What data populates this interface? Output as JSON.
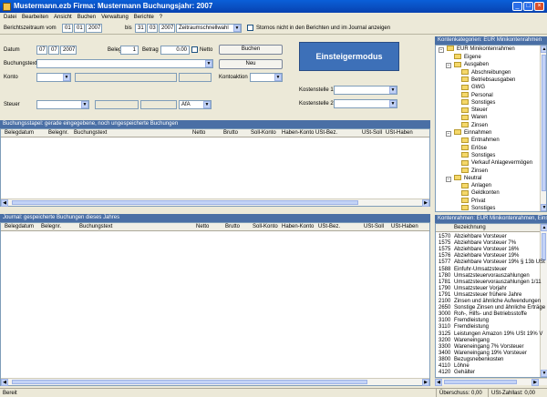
{
  "window": {
    "title": "Mustermann.ezb  Firma: Mustermann  Buchungsjahr: 2007"
  },
  "menu": [
    "Datei",
    "Bearbeiten",
    "Ansicht",
    "Buchen",
    "Verwaltung",
    "Berichte",
    "?"
  ],
  "period": {
    "label": "Berichtszeitraum vom",
    "from_d": "01",
    "from_m": "01",
    "from_y": "2007",
    "bis": "bis",
    "to_d": "31",
    "to_m": "03",
    "to_y": "2007",
    "mode": "Zeitraumschnellwahl",
    "storno_label": "Stornos nicht in den Berichten und im Journal anzeigen"
  },
  "form": {
    "datum_label": "Datum",
    "datum_d": "07",
    "datum_m": "07",
    "datum_y": "2007",
    "beleg_label": "Beleg",
    "beleg_value": "1",
    "betrag_label": "Betrag",
    "betrag_value": "0.00",
    "netto_label": "Netto",
    "buchen_label": "Buchen",
    "neu_label": "Neu",
    "buchungstext_label": "Buchungstext",
    "konto_label": "Konto",
    "kontoaktion_label": "Kontoaktion",
    "kostenstelle1_label": "Kostenstelle 1",
    "kostenstelle2_label": "Kostenstelle 2",
    "steuer_label": "Steuer",
    "afa_label": "AfA",
    "einsteiger_label": "Einsteigermodus"
  },
  "stapel": {
    "title": "Buchungsstapel: gerade eingegebene, noch ungespeicherte Buchungen",
    "columns": [
      "Belegdatum",
      "Belegnr.",
      "Buchungstext",
      "Netto",
      "Brutto",
      "Soll-Konto",
      "Haben-Konto",
      "USt-Bez.",
      "USt-Soll",
      "USt-Haben"
    ]
  },
  "journal": {
    "title": "Journal: gespeicherte Buchungen dieses Jahres",
    "columns": [
      "Belegdatum",
      "Belegnr.",
      "Buchungstext",
      "Netto",
      "Brutto",
      "Soll-Konto",
      "Haben-Konto",
      "USt-Bez.",
      "USt-Soll",
      "USt-Haben"
    ]
  },
  "categories": {
    "title": "Kontenkategorien: EUR Minikontenrahmen",
    "root": "EUR Minikontenrahmen",
    "items": [
      {
        "label": "Eigene",
        "level": 2
      },
      {
        "label": "Ausgaben",
        "level": 2
      },
      {
        "label": "Abschreibungen",
        "level": 3
      },
      {
        "label": "Betriebsausgaben",
        "level": 3
      },
      {
        "label": "GWG",
        "level": 3
      },
      {
        "label": "Personal",
        "level": 3
      },
      {
        "label": "Sonstiges",
        "level": 3
      },
      {
        "label": "Steuer",
        "level": 3
      },
      {
        "label": "Waren",
        "level": 3
      },
      {
        "label": "Zinsen",
        "level": 3
      },
      {
        "label": "Einnahmen",
        "level": 2
      },
      {
        "label": "Entnahmen",
        "level": 3
      },
      {
        "label": "Erlöse",
        "level": 3
      },
      {
        "label": "Sonstiges",
        "level": 3
      },
      {
        "label": "Verkauf Anlagevermögen",
        "level": 3
      },
      {
        "label": "Zinsen",
        "level": 3
      },
      {
        "label": "Neutral",
        "level": 2
      },
      {
        "label": "Anlagen",
        "level": 3
      },
      {
        "label": "Geldkonten",
        "level": 3
      },
      {
        "label": "Privat",
        "level": 3
      },
      {
        "label": "Sonstiges",
        "level": 3
      }
    ]
  },
  "accounts": {
    "title": "Kontenrahmen: EUR Minikontenrahmen, Einste",
    "col_nr": "",
    "col_name": "Bezeichnung",
    "rows": [
      {
        "nr": "1570",
        "name": "Abziehbare Vorsteuer"
      },
      {
        "nr": "1575",
        "name": "Abziehbare Vorsteuer 7%"
      },
      {
        "nr": "1575",
        "name": "Abziehbare Vorsteuer 16%"
      },
      {
        "nr": "1576",
        "name": "Abziehbare Vorsteuer 19%"
      },
      {
        "nr": "1577",
        "name": "Abziehbare Vorsteuer 19% § 13b USt"
      },
      {
        "nr": "1588",
        "name": "Einfuhr-Umsatzsteuer"
      },
      {
        "nr": "1780",
        "name": "Umsatzsteuervorauszahlungen"
      },
      {
        "nr": "1781",
        "name": "Umsatzsteuervorauszahlungen 1/11"
      },
      {
        "nr": "1790",
        "name": "Umsatzsteuer Vorjahr"
      },
      {
        "nr": "1791",
        "name": "Umsatzsteuer frühere Jahre"
      },
      {
        "nr": "2100",
        "name": "Zinsen und ähnliche Aufwendungen"
      },
      {
        "nr": "2650",
        "name": "Sonstige Zinsen und ähnliche Erträge"
      },
      {
        "nr": "3000",
        "name": "Roh-, Hilfs- und Betriebsstoffe"
      },
      {
        "nr": "3100",
        "name": "Fremdleistung"
      },
      {
        "nr": "3110",
        "name": "Fremdleistung"
      },
      {
        "nr": "3125",
        "name": "Leistungen Amazon 19% USt 19% V"
      },
      {
        "nr": "3200",
        "name": "Wareneingang"
      },
      {
        "nr": "3300",
        "name": "Wareneingang 7% Vorsteuer"
      },
      {
        "nr": "3400",
        "name": "Wareneingang 19% Vorsteuer"
      },
      {
        "nr": "3800",
        "name": "Bezugsnebenkosten"
      },
      {
        "nr": "4110",
        "name": "Löhne"
      },
      {
        "nr": "4120",
        "name": "Gehälter"
      }
    ]
  },
  "status": {
    "left": "Bereit",
    "ueberschuss": "Überschuss: 0,00",
    "ust_zahllast": "USt-Zahllast: 0,00"
  }
}
